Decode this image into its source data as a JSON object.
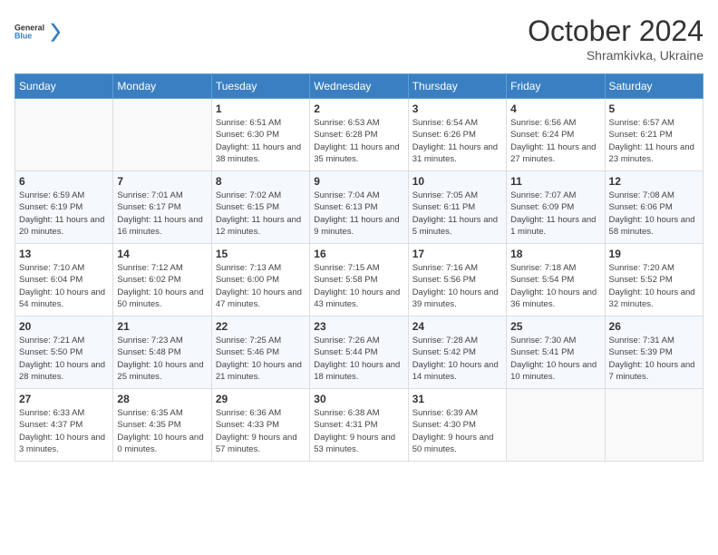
{
  "header": {
    "logo": "GeneralBlue",
    "month": "October 2024",
    "location": "Shramkivka, Ukraine"
  },
  "weekdays": [
    "Sunday",
    "Monday",
    "Tuesday",
    "Wednesday",
    "Thursday",
    "Friday",
    "Saturday"
  ],
  "weeks": [
    [
      {
        "day": "",
        "info": ""
      },
      {
        "day": "",
        "info": ""
      },
      {
        "day": "1",
        "sunrise": "6:51 AM",
        "sunset": "6:30 PM",
        "daylight": "11 hours and 38 minutes."
      },
      {
        "day": "2",
        "sunrise": "6:53 AM",
        "sunset": "6:28 PM",
        "daylight": "11 hours and 35 minutes."
      },
      {
        "day": "3",
        "sunrise": "6:54 AM",
        "sunset": "6:26 PM",
        "daylight": "11 hours and 31 minutes."
      },
      {
        "day": "4",
        "sunrise": "6:56 AM",
        "sunset": "6:24 PM",
        "daylight": "11 hours and 27 minutes."
      },
      {
        "day": "5",
        "sunrise": "6:57 AM",
        "sunset": "6:21 PM",
        "daylight": "11 hours and 23 minutes."
      }
    ],
    [
      {
        "day": "6",
        "sunrise": "6:59 AM",
        "sunset": "6:19 PM",
        "daylight": "11 hours and 20 minutes."
      },
      {
        "day": "7",
        "sunrise": "7:01 AM",
        "sunset": "6:17 PM",
        "daylight": "11 hours and 16 minutes."
      },
      {
        "day": "8",
        "sunrise": "7:02 AM",
        "sunset": "6:15 PM",
        "daylight": "11 hours and 12 minutes."
      },
      {
        "day": "9",
        "sunrise": "7:04 AM",
        "sunset": "6:13 PM",
        "daylight": "11 hours and 9 minutes."
      },
      {
        "day": "10",
        "sunrise": "7:05 AM",
        "sunset": "6:11 PM",
        "daylight": "11 hours and 5 minutes."
      },
      {
        "day": "11",
        "sunrise": "7:07 AM",
        "sunset": "6:09 PM",
        "daylight": "11 hours and 1 minute."
      },
      {
        "day": "12",
        "sunrise": "7:08 AM",
        "sunset": "6:06 PM",
        "daylight": "10 hours and 58 minutes."
      }
    ],
    [
      {
        "day": "13",
        "sunrise": "7:10 AM",
        "sunset": "6:04 PM",
        "daylight": "10 hours and 54 minutes."
      },
      {
        "day": "14",
        "sunrise": "7:12 AM",
        "sunset": "6:02 PM",
        "daylight": "10 hours and 50 minutes."
      },
      {
        "day": "15",
        "sunrise": "7:13 AM",
        "sunset": "6:00 PM",
        "daylight": "10 hours and 47 minutes."
      },
      {
        "day": "16",
        "sunrise": "7:15 AM",
        "sunset": "5:58 PM",
        "daylight": "10 hours and 43 minutes."
      },
      {
        "day": "17",
        "sunrise": "7:16 AM",
        "sunset": "5:56 PM",
        "daylight": "10 hours and 39 minutes."
      },
      {
        "day": "18",
        "sunrise": "7:18 AM",
        "sunset": "5:54 PM",
        "daylight": "10 hours and 36 minutes."
      },
      {
        "day": "19",
        "sunrise": "7:20 AM",
        "sunset": "5:52 PM",
        "daylight": "10 hours and 32 minutes."
      }
    ],
    [
      {
        "day": "20",
        "sunrise": "7:21 AM",
        "sunset": "5:50 PM",
        "daylight": "10 hours and 28 minutes."
      },
      {
        "day": "21",
        "sunrise": "7:23 AM",
        "sunset": "5:48 PM",
        "daylight": "10 hours and 25 minutes."
      },
      {
        "day": "22",
        "sunrise": "7:25 AM",
        "sunset": "5:46 PM",
        "daylight": "10 hours and 21 minutes."
      },
      {
        "day": "23",
        "sunrise": "7:26 AM",
        "sunset": "5:44 PM",
        "daylight": "10 hours and 18 minutes."
      },
      {
        "day": "24",
        "sunrise": "7:28 AM",
        "sunset": "5:42 PM",
        "daylight": "10 hours and 14 minutes."
      },
      {
        "day": "25",
        "sunrise": "7:30 AM",
        "sunset": "5:41 PM",
        "daylight": "10 hours and 10 minutes."
      },
      {
        "day": "26",
        "sunrise": "7:31 AM",
        "sunset": "5:39 PM",
        "daylight": "10 hours and 7 minutes."
      }
    ],
    [
      {
        "day": "27",
        "sunrise": "6:33 AM",
        "sunset": "4:37 PM",
        "daylight": "10 hours and 3 minutes."
      },
      {
        "day": "28",
        "sunrise": "6:35 AM",
        "sunset": "4:35 PM",
        "daylight": "10 hours and 0 minutes."
      },
      {
        "day": "29",
        "sunrise": "6:36 AM",
        "sunset": "4:33 PM",
        "daylight": "9 hours and 57 minutes."
      },
      {
        "day": "30",
        "sunrise": "6:38 AM",
        "sunset": "4:31 PM",
        "daylight": "9 hours and 53 minutes."
      },
      {
        "day": "31",
        "sunrise": "6:39 AM",
        "sunset": "4:30 PM",
        "daylight": "9 hours and 50 minutes."
      },
      {
        "day": "",
        "info": ""
      },
      {
        "day": "",
        "info": ""
      }
    ]
  ]
}
